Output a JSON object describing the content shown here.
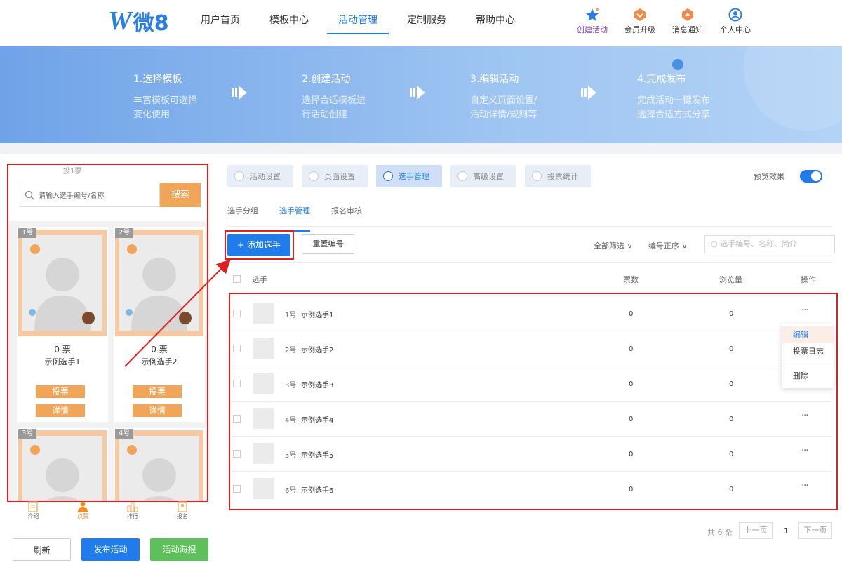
{
  "header": {
    "logo_letter": "W",
    "logo_text": "微8",
    "nav": [
      "用户首页",
      "模板中心",
      "活动管理",
      "定制服务",
      "帮助中心"
    ],
    "nav_active": 2,
    "icons": [
      {
        "label": "创建活动",
        "icon": "star-icon"
      },
      {
        "label": "会员升级",
        "icon": "vip-icon"
      },
      {
        "label": "消息通知",
        "icon": "bell-icon"
      },
      {
        "label": "个人中心",
        "icon": "user-icon"
      }
    ]
  },
  "steps": [
    {
      "title": "1.选择模板",
      "line1": "丰富模板可选择",
      "line2": "变化使用"
    },
    {
      "title": "2.创建活动",
      "line1": "选择合适模板进",
      "line2": "行活动创建"
    },
    {
      "title": "3.编辑活动",
      "line1": "自定义页面设置/",
      "line2": "活动详情/规则等"
    },
    {
      "title": "4.完成发布",
      "line1": "完成活动一键发布",
      "line2": "选择合适方式分享"
    }
  ],
  "preview": {
    "vote_hint": "投1票",
    "search_placeholder": "请输入选手编号/名称",
    "search_button": "搜索",
    "cards": [
      {
        "badge": "1号",
        "votes": "0 票",
        "name": "示例选手1",
        "vote_btn": "投票",
        "detail_btn": "详情"
      },
      {
        "badge": "2号",
        "votes": "0 票",
        "name": "示例选手2",
        "vote_btn": "投票",
        "detail_btn": "详情"
      },
      {
        "badge": "3号"
      },
      {
        "badge": "4号"
      }
    ],
    "bottom_nav": [
      {
        "label": "介绍",
        "icon": "doc-icon"
      },
      {
        "label": "点赞",
        "icon": "person-icon",
        "active": true
      },
      {
        "label": "排行",
        "icon": "rank-icon"
      },
      {
        "label": "报名",
        "icon": "signup-icon"
      }
    ]
  },
  "actions": {
    "refresh": "刷新",
    "publish": "发布活动",
    "poster": "活动海报"
  },
  "settings_tabs": [
    "活动设置",
    "页面设置",
    "选手管理",
    "高级设置",
    "投票统计"
  ],
  "settings_tab_active": 2,
  "preview_toggle_label": "预览效果",
  "sub_tabs": [
    "选手分组",
    "选手管理",
    "报名审核"
  ],
  "sub_tab_active": 1,
  "toolbar": {
    "add": "+ 添加选手",
    "reset": "重置编号",
    "filter_all": "全部筛选 ∨",
    "sort": "编号正序 ∨",
    "search_placeholder": "选手编号、名称、简介"
  },
  "table": {
    "headers": {
      "player": "选手",
      "votes": "票数",
      "views": "浏览量",
      "ops": "操作"
    },
    "rows": [
      {
        "num": "1号",
        "name": "示例选手1",
        "votes": "0",
        "views": "0",
        "op": "···"
      },
      {
        "num": "2号",
        "name": "示例选手2",
        "votes": "0",
        "views": "0",
        "op": ""
      },
      {
        "num": "3号",
        "name": "示例选手3",
        "votes": "0",
        "views": "0",
        "op": ""
      },
      {
        "num": "4号",
        "name": "示例选手4",
        "votes": "0",
        "views": "0",
        "op": "···"
      },
      {
        "num": "5号",
        "name": "示例选手5",
        "votes": "0",
        "views": "0",
        "op": "···"
      },
      {
        "num": "6号",
        "name": "示例选手6",
        "votes": "0",
        "views": "0",
        "op": "···"
      }
    ]
  },
  "dropdown": [
    "编辑",
    "投票日志",
    "删除"
  ],
  "pagination": {
    "total": "共 6 条",
    "prev": "上一页",
    "page": "1",
    "next": "下一页"
  },
  "colors": {
    "accent": "#1f7cea",
    "orange": "#f0a558",
    "green": "#5ec05a",
    "red": "#e02020"
  }
}
